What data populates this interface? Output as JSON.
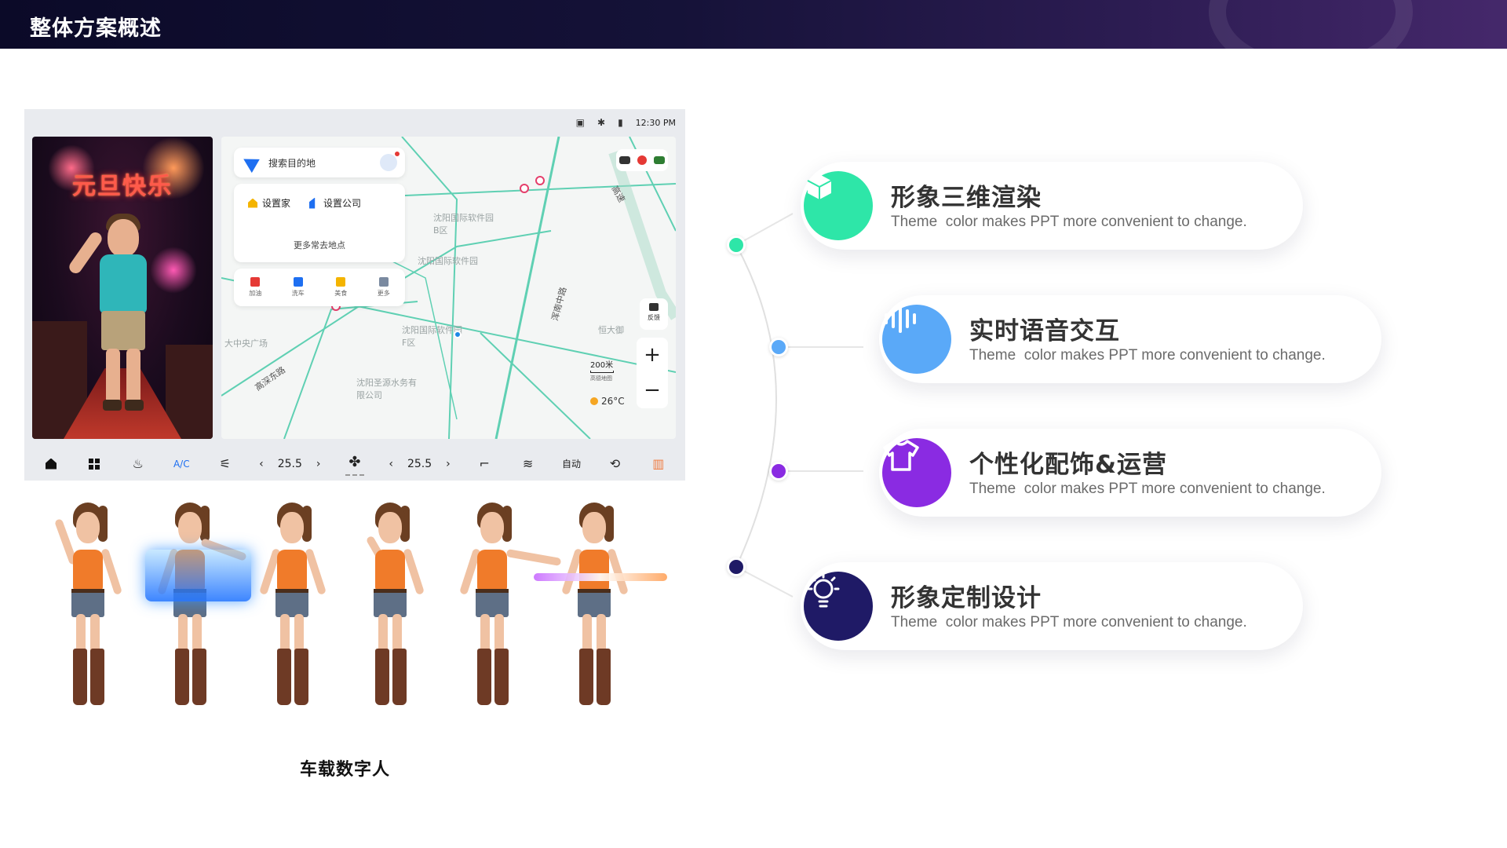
{
  "header": {
    "title": "整体方案概述"
  },
  "car_ui": {
    "status": {
      "time": "12:30 PM"
    },
    "avatar_banner": "元旦快乐",
    "search": {
      "placeholder": "搜索目的地"
    },
    "quick": {
      "home": "设置家",
      "company": "设置公司",
      "more": "更多常去地点"
    },
    "categories": [
      "加油",
      "洗车",
      "美食",
      "更多"
    ],
    "map_labels": [
      "沈阳国际软件园B区",
      "沈阳国际软件园",
      "沈阳国际软件园F区",
      "大中央广场",
      "高深东路",
      "沈阳圣源水务有限公司",
      "恒大御",
      "高速",
      "浑南中路"
    ],
    "feedback": "反馈",
    "scale": {
      "value": "200米",
      "sub": "高德地图"
    },
    "weather": "26°C",
    "zoom_in": "+",
    "zoom_out": "−",
    "bottom": {
      "ac": "A/C",
      "left_temp": "25.5",
      "right_temp": "25.5",
      "auto": "自动",
      "prev": "‹",
      "next": "›"
    }
  },
  "caption": "车载数字人",
  "features": [
    {
      "title": "形象三维渲染",
      "desc": "Theme  color makes PPT more convenient to change.",
      "icon": "cube-icon",
      "color": "#2ee6a8"
    },
    {
      "title": "实时语音交互",
      "desc": "Theme  color makes PPT more convenient to change.",
      "icon": "voice-wave-icon",
      "color": "#5aa9f8"
    },
    {
      "title": "个性化配饰&运营",
      "desc": "Theme  color makes PPT more convenient to change.",
      "icon": "tshirt-icon",
      "color": "#8a2be2"
    },
    {
      "title": "形象定制设计",
      "desc": "Theme  color makes PPT more convenient to change.",
      "icon": "lightbulb-icon",
      "color": "#1f1a66"
    }
  ]
}
